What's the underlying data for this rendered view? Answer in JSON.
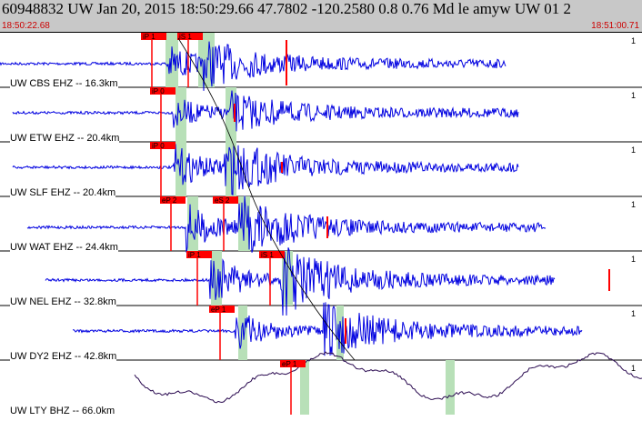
{
  "header": {
    "title": "60948832  UW Jan 20, 2015 18:50:29.66    47.7802 -120.2580  0.8 0.76 Md le amyw UW 01    2"
  },
  "timebar": {
    "start": "18:50:22.68",
    "end": "18:51:00.71"
  },
  "colors": {
    "trace": "#0000e0",
    "lowtrace": "#2a0a50",
    "pick": "#ff0000",
    "window": "#b8e0b8",
    "header": "#c8c8c8"
  },
  "channels": [
    {
      "label": "UW CBS EHZ -- 16.3km",
      "picks": [
        "iP 1",
        "iS 1"
      ]
    },
    {
      "label": "UW ETW EHZ -- 20.4km",
      "picks": [
        "iP 0"
      ]
    },
    {
      "label": "UW SLF EHZ -- 20.4km",
      "picks": [
        "iP 0"
      ]
    },
    {
      "label": "UW WAT EHZ -- 24.4km",
      "picks": [
        "eP 2",
        "eS 2"
      ]
    },
    {
      "label": "UW NEL EHZ -- 32.8km",
      "picks": [
        "iP 1",
        "iS 1"
      ]
    },
    {
      "label": "UW DY2 EHZ -- 42.8km",
      "picks": [
        "eP 1"
      ]
    },
    {
      "label": "UW LTY BHZ -- 66.0km",
      "picks": [
        "eP 1"
      ]
    }
  ],
  "scale_mark": "1"
}
